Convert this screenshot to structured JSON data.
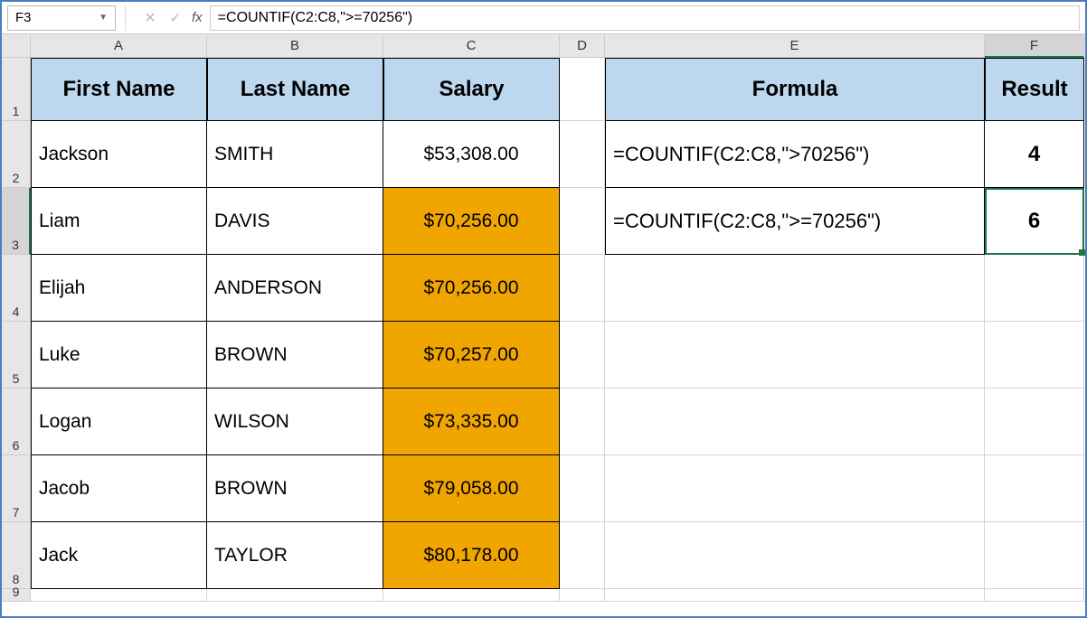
{
  "namebox": "F3",
  "fx_label": "fx",
  "formula_bar": "=COUNTIF(C2:C8,\">=70256\")",
  "col_labels": [
    "A",
    "B",
    "C",
    "D",
    "E",
    "F"
  ],
  "row_labels": [
    "1",
    "2",
    "3",
    "4",
    "5",
    "6",
    "7",
    "8",
    "9"
  ],
  "headers": {
    "A": "First Name",
    "B": "Last Name",
    "C": "Salary",
    "E": "Formula",
    "F": "Result"
  },
  "table": [
    {
      "first": "Jackson",
      "last": "SMITH",
      "salary": "$53,308.00",
      "hl": false
    },
    {
      "first": "Liam",
      "last": "DAVIS",
      "salary": "$70,256.00",
      "hl": true
    },
    {
      "first": "Elijah",
      "last": "ANDERSON",
      "salary": "$70,256.00",
      "hl": true
    },
    {
      "first": "Luke",
      "last": "BROWN",
      "salary": "$70,257.00",
      "hl": true
    },
    {
      "first": "Logan",
      "last": "WILSON",
      "salary": "$73,335.00",
      "hl": true
    },
    {
      "first": "Jacob",
      "last": "BROWN",
      "salary": "$79,058.00",
      "hl": true
    },
    {
      "first": "Jack",
      "last": "TAYLOR",
      "salary": "$80,178.00",
      "hl": true
    }
  ],
  "formulas": [
    {
      "text": "=COUNTIF(C2:C8,\">70256\")",
      "result": "4"
    },
    {
      "text": "=COUNTIF(C2:C8,\">=70256\")",
      "result": "6"
    }
  ],
  "icons": {
    "cancel": "✕",
    "enter": "✓",
    "dropdown": "▼"
  },
  "colors": {
    "header_fill": "#bdd7ee",
    "highlight": "#f0a500",
    "selection": "#217346"
  },
  "chart_data": {
    "type": "table",
    "title": "COUNTIF salary example",
    "columns": [
      "First Name",
      "Last Name",
      "Salary"
    ],
    "rows": [
      [
        "Jackson",
        "SMITH",
        53308.0
      ],
      [
        "Liam",
        "DAVIS",
        70256.0
      ],
      [
        "Elijah",
        "ANDERSON",
        70256.0
      ],
      [
        "Luke",
        "BROWN",
        70257.0
      ],
      [
        "Logan",
        "WILSON",
        73335.0
      ],
      [
        "Jacob",
        "BROWN",
        79058.0
      ],
      [
        "Jack",
        "TAYLOR",
        80178.0
      ]
    ],
    "derived": [
      {
        "formula": "=COUNTIF(C2:C8,\">70256\")",
        "result": 4
      },
      {
        "formula": "=COUNTIF(C2:C8,\">=70256\")",
        "result": 6
      }
    ]
  }
}
